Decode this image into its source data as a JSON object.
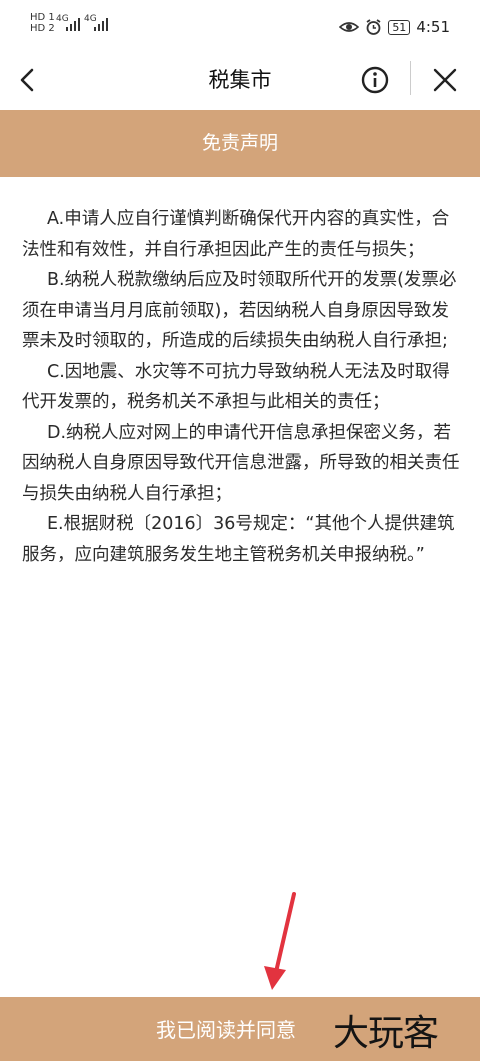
{
  "status_bar": {
    "sim1": "HD 1",
    "sim2": "HD 2",
    "net1": "4G",
    "net2": "4G",
    "battery": "51",
    "time": "4:51"
  },
  "navbar": {
    "title": "税集市"
  },
  "banner": {
    "title": "免责声明"
  },
  "content": {
    "paragraphs": [
      "A.申请人应自行谨慎判断确保代开内容的真实性，合法性和有效性，并自行承担因此产生的责任与损失；",
      "B.纳税人税款缴纳后应及时领取所代开的发票(发票必须在申请当月月底前领取)，若因纳税人自身原因导致发票未及时领取的，所造成的后续损失由纳税人自行承担;",
      "C.因地震、水灾等不可抗力导致纳税人无法及时取得代开发票的，税务机关不承担与此相关的责任；",
      "D.纳税人应对网上的申请代开信息承担保密义务，若因纳税人自身原因导致代开信息泄露，所导致的相关责任与损失由纳税人自行承担；",
      "E.根据财税〔2016〕36号规定：“其他个人提供建筑服务，应向建筑服务发生地主管税务机关申报纳税。”"
    ]
  },
  "footer": {
    "agree_label": "我已阅读并同意",
    "watermark": "大玩客"
  },
  "colors": {
    "accent": "#d3a47a",
    "arrow": "#e2333f"
  },
  "icons": [
    "back-arrow-icon",
    "info-icon",
    "close-icon",
    "eye-icon",
    "alarm-icon"
  ]
}
